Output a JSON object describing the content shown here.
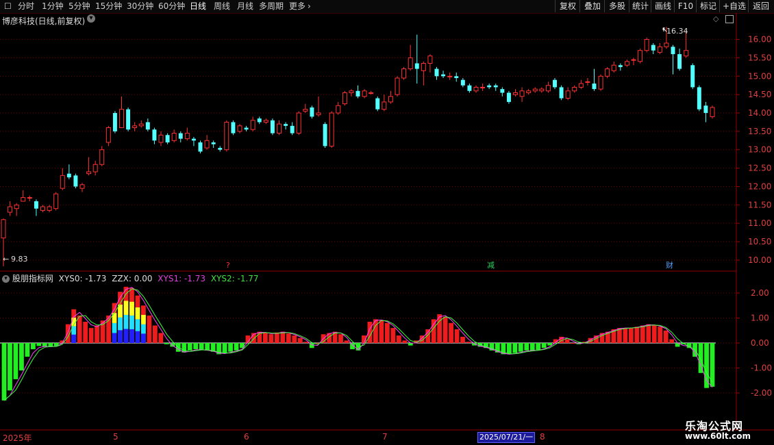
{
  "toolbar": {
    "periods": [
      "分时",
      "1分钟",
      "5分钟",
      "15分钟",
      "30分钟",
      "60分钟",
      "日线",
      "周线",
      "月线",
      "多周期",
      "更多"
    ],
    "active_period": "日线",
    "right_buttons": [
      "复权",
      "叠加",
      "多股",
      "统计",
      "画线",
      "F10",
      "标记",
      "+自选",
      "返回"
    ]
  },
  "stock": {
    "title": "博彦科技(日线,前复权)",
    "high_label": "16.34",
    "low_label": "9.83"
  },
  "price_axis": [
    "16.00",
    "15.50",
    "15.00",
    "14.50",
    "14.00",
    "13.50",
    "13.00",
    "12.50",
    "12.00",
    "11.50",
    "11.00",
    "10.50",
    "10.00"
  ],
  "markers": [
    {
      "text": "?",
      "color": "#ff3030"
    },
    {
      "text": "减",
      "color": "#30d060"
    },
    {
      "text": "财",
      "color": "#5aa0ff"
    }
  ],
  "indicator": {
    "name": "股朋指标网",
    "xys0_label": "XYS0: -1.73",
    "zzx_label": "ZZX: 0.00",
    "xys1_label": "XYS1: -1.73",
    "xys2_label": "XYS2: -1.77",
    "axis": [
      "2.00",
      "1.00",
      "0.00",
      "-1.00",
      "-2.00"
    ]
  },
  "dates": {
    "labels": [
      "2025年",
      "5",
      "6",
      "7",
      "8"
    ],
    "cursor": "2025/07/21/一"
  },
  "watermark": {
    "line1": "乐淘公式网",
    "line2": "www.60lt.com"
  },
  "colors": {
    "up": "#ff3232",
    "down": "#54ffff",
    "grid": "#7a0000",
    "axis_text": "#e04040"
  },
  "chart_data": [
    {
      "type": "candlestick",
      "title": "博彦科技(日线,前复权)",
      "ylim": [
        9.7,
        16.7
      ],
      "candles": [
        [
          10.6,
          11.1,
          11.13,
          9.83
        ],
        [
          11.3,
          11.45,
          11.6,
          11.2
        ],
        [
          11.4,
          11.5,
          11.55,
          11.2
        ],
        [
          11.6,
          11.7,
          11.9,
          11.6
        ],
        [
          11.7,
          11.7,
          11.75,
          11.6
        ],
        [
          11.6,
          11.4,
          11.65,
          11.2
        ],
        [
          11.35,
          11.45,
          11.5,
          11.3
        ],
        [
          11.35,
          11.45,
          11.5,
          11.3
        ],
        [
          11.4,
          11.8,
          11.85,
          11.35
        ],
        [
          11.95,
          12.3,
          12.5,
          11.9
        ],
        [
          12.35,
          12.25,
          12.6,
          12.2
        ],
        [
          12.3,
          12.0,
          12.35,
          11.95
        ],
        [
          11.95,
          12.05,
          12.1,
          11.85
        ],
        [
          12.35,
          12.4,
          12.8,
          12.3
        ],
        [
          12.4,
          12.6,
          12.7,
          12.3
        ],
        [
          12.6,
          13.0,
          13.1,
          12.55
        ],
        [
          13.2,
          13.6,
          13.65,
          13.1
        ],
        [
          14.0,
          13.5,
          14.05,
          13.45
        ],
        [
          13.6,
          14.1,
          14.45,
          13.6
        ],
        [
          14.1,
          13.55,
          14.15,
          13.5
        ],
        [
          13.6,
          13.65,
          13.75,
          13.5
        ],
        [
          13.65,
          13.7,
          13.8,
          13.6
        ],
        [
          13.75,
          13.55,
          13.85,
          13.5
        ],
        [
          13.55,
          13.25,
          13.6,
          13.15
        ],
        [
          13.2,
          13.4,
          13.5,
          13.1
        ],
        [
          13.4,
          13.2,
          13.45,
          13.15
        ],
        [
          13.25,
          13.45,
          13.55,
          13.2
        ],
        [
          13.45,
          13.3,
          13.5,
          13.2
        ],
        [
          13.3,
          13.45,
          13.6,
          13.25
        ],
        [
          13.3,
          13.25,
          13.35,
          13.1
        ],
        [
          13.2,
          12.95,
          13.25,
          12.9
        ],
        [
          13.05,
          13.25,
          13.4,
          13.0
        ],
        [
          13.2,
          13.15,
          13.25,
          13.05
        ],
        [
          13.05,
          13.0,
          13.1,
          12.95
        ],
        [
          13.0,
          13.75,
          13.8,
          12.95
        ],
        [
          13.75,
          13.45,
          13.8,
          13.4
        ],
        [
          13.5,
          13.65,
          13.7,
          13.45
        ],
        [
          13.6,
          13.55,
          13.65,
          13.5
        ],
        [
          13.55,
          13.8,
          13.9,
          13.5
        ],
        [
          13.85,
          13.75,
          13.9,
          13.7
        ],
        [
          13.75,
          13.8,
          13.85,
          13.7
        ],
        [
          13.8,
          13.45,
          13.85,
          13.4
        ],
        [
          13.45,
          13.7,
          13.8,
          13.4
        ],
        [
          13.7,
          13.65,
          13.75,
          13.55
        ],
        [
          13.65,
          13.45,
          13.75,
          13.4
        ],
        [
          13.45,
          14.0,
          14.05,
          13.4
        ],
        [
          14.05,
          14.1,
          14.25,
          14.0
        ],
        [
          14.15,
          13.9,
          14.2,
          13.85
        ],
        [
          13.95,
          14.0,
          14.45,
          13.9
        ],
        [
          13.7,
          13.1,
          13.75,
          13.05
        ],
        [
          13.1,
          14.0,
          14.05,
          13.05
        ],
        [
          14.0,
          14.2,
          14.3,
          13.95
        ],
        [
          14.25,
          14.55,
          14.6,
          14.2
        ],
        [
          14.55,
          14.6,
          14.65,
          14.45
        ],
        [
          14.6,
          14.45,
          14.75,
          14.4
        ],
        [
          14.45,
          14.6,
          14.65,
          14.4
        ],
        [
          14.55,
          14.55,
          14.6,
          14.5
        ],
        [
          14.4,
          14.1,
          14.45,
          14.05
        ],
        [
          14.1,
          14.3,
          14.5,
          14.05
        ],
        [
          14.3,
          14.45,
          14.6,
          14.25
        ],
        [
          14.5,
          14.95,
          15.0,
          14.45
        ],
        [
          14.95,
          15.2,
          15.25,
          14.9
        ],
        [
          15.2,
          15.5,
          15.85,
          15.15
        ],
        [
          15.35,
          15.2,
          16.13,
          14.8
        ],
        [
          15.15,
          15.35,
          15.4,
          14.75
        ],
        [
          15.35,
          15.55,
          15.6,
          15.1
        ],
        [
          15.2,
          15.0,
          15.25,
          14.9
        ],
        [
          15.05,
          15.0,
          15.15,
          14.95
        ],
        [
          15.0,
          15.0,
          15.1,
          14.9
        ],
        [
          15.0,
          14.95,
          15.1,
          14.85
        ],
        [
          14.9,
          14.75,
          14.95,
          14.7
        ],
        [
          14.75,
          14.6,
          14.8,
          14.55
        ],
        [
          14.6,
          14.7,
          14.75,
          14.55
        ],
        [
          14.7,
          14.7,
          14.8,
          14.6
        ],
        [
          14.75,
          14.7,
          14.8,
          14.65
        ],
        [
          14.75,
          14.7,
          14.8,
          14.6
        ],
        [
          14.65,
          14.55,
          14.7,
          14.45
        ],
        [
          14.55,
          14.3,
          14.6,
          14.25
        ],
        [
          14.5,
          14.55,
          14.65,
          14.45
        ],
        [
          14.45,
          14.6,
          14.7,
          14.3
        ],
        [
          14.55,
          14.6,
          14.65,
          14.5
        ],
        [
          14.6,
          14.65,
          14.7,
          14.55
        ],
        [
          14.6,
          14.65,
          14.7,
          14.55
        ],
        [
          14.6,
          14.75,
          14.85,
          14.55
        ],
        [
          14.9,
          14.7,
          14.95,
          14.65
        ],
        [
          14.7,
          14.4,
          14.75,
          14.35
        ],
        [
          14.4,
          14.6,
          14.7,
          14.35
        ],
        [
          14.6,
          14.7,
          14.75,
          14.55
        ],
        [
          14.7,
          14.8,
          14.9,
          14.65
        ],
        [
          14.85,
          14.85,
          14.95,
          14.75
        ],
        [
          14.8,
          14.65,
          15.2,
          14.6
        ],
        [
          14.65,
          15.0,
          15.05,
          14.6
        ],
        [
          15.0,
          15.2,
          15.25,
          14.95
        ],
        [
          15.15,
          15.3,
          15.4,
          15.1
        ],
        [
          15.3,
          15.25,
          15.35,
          15.15
        ],
        [
          15.3,
          15.4,
          15.45,
          15.25
        ],
        [
          15.45,
          15.45,
          15.5,
          15.3
        ],
        [
          15.4,
          15.7,
          15.75,
          15.35
        ],
        [
          15.7,
          16.0,
          16.05,
          15.65
        ],
        [
          15.85,
          15.7,
          15.9,
          15.6
        ],
        [
          15.65,
          15.8,
          15.9,
          15.6
        ],
        [
          15.8,
          15.9,
          16.34,
          15.75
        ],
        [
          15.8,
          15.6,
          15.85,
          15.05
        ],
        [
          15.6,
          15.2,
          15.75,
          15.15
        ],
        [
          15.55,
          15.7,
          16.25,
          15.5
        ],
        [
          15.3,
          14.7,
          15.35,
          14.65
        ],
        [
          14.7,
          14.1,
          14.75,
          14.05
        ],
        [
          14.2,
          14.0,
          14.3,
          13.75
        ],
        [
          13.9,
          14.15,
          14.2,
          13.85
        ]
      ]
    },
    {
      "type": "bar",
      "title": "股朋指标网",
      "ylim": [
        -2.5,
        2.5
      ],
      "series": [
        {
          "name": "XYS0",
          "values": [
            -2.3,
            -1.9,
            -1.45,
            -1.1,
            -0.55,
            -0.25,
            -0.12,
            -0.15,
            -0.15,
            -0.12,
            0.1,
            0.75,
            1.35,
            1.1,
            0.85,
            0.6,
            0.7,
            0.9,
            1.1,
            1.6,
            2.05,
            2.25,
            2.2,
            1.9,
            1.5,
            1.1,
            0.7,
            0.4,
            -0.05,
            -0.15,
            -0.35,
            -0.38,
            -0.3,
            -0.25,
            -0.28,
            -0.3,
            -0.35,
            -0.45,
            -0.4,
            -0.35,
            -0.3,
            -0.2,
            0.3,
            0.4,
            0.45,
            0.4,
            0.35,
            0.42,
            0.45,
            0.38,
            0.3,
            0.2,
            0.05,
            -0.2,
            0.0,
            0.35,
            0.4,
            0.45,
            0.35,
            0.1,
            -0.25,
            -0.3,
            0.3,
            0.85,
            0.95,
            0.9,
            0.8,
            0.6,
            0.3,
            0.1,
            -0.1,
            0.1,
            0.3,
            0.55,
            0.95,
            1.15,
            1.05,
            0.8,
            0.55,
            0.25,
            0.05,
            -0.1,
            -0.15,
            -0.2,
            -0.3,
            -0.38,
            -0.45,
            -0.45,
            -0.4,
            -0.35,
            -0.3,
            -0.3,
            -0.28,
            -0.2,
            -0.1,
            0.15,
            0.25,
            0.15,
            0.0,
            -0.05,
            0.05,
            0.2,
            0.3,
            0.4,
            0.45,
            0.55,
            0.6,
            0.6,
            0.6,
            0.65,
            0.7,
            0.75,
            0.7,
            0.65,
            0.5,
            0.15,
            -0.15,
            -0.05,
            -0.2,
            -0.55,
            -1.2,
            -1.8,
            -1.75
          ]
        },
        {
          "name": "XYS1",
          "values": []
        },
        {
          "name": "XYS2",
          "values": []
        }
      ]
    }
  ]
}
